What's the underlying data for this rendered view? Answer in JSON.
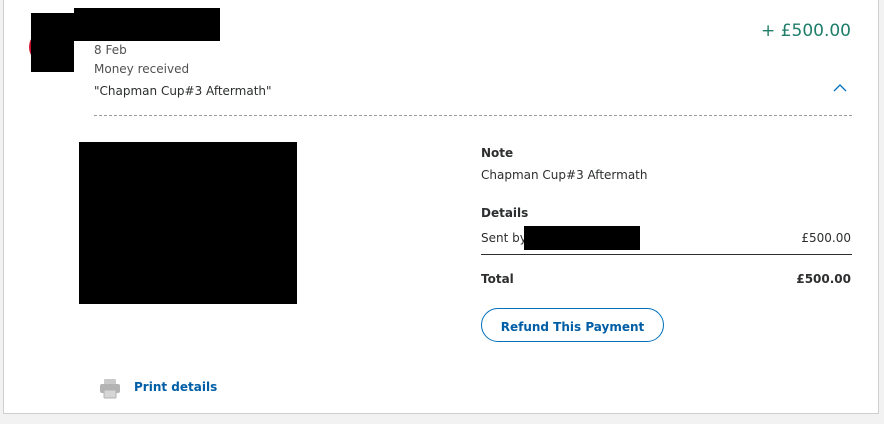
{
  "transaction": {
    "date": "8 Feb",
    "type": "Money received",
    "memo": "\"Chapman Cup#3 Aftermath\"",
    "amount": "+ £500.00"
  },
  "details": {
    "note_heading": "Note",
    "note_text": "Chapman Cup#3 Aftermath",
    "details_heading": "Details",
    "sent_by_label": "Sent by",
    "sent_amount": "£500.00",
    "total_label": "Total",
    "total_amount": "£500.00"
  },
  "actions": {
    "refund_label": "Refund This Payment",
    "print_label": "Print details"
  },
  "colors": {
    "amount_positive": "#1f7d6a",
    "link": "#005ea6",
    "button_border": "#0070ba"
  },
  "icons": {
    "collapse": "chevron-up-icon",
    "print": "printer-icon"
  }
}
